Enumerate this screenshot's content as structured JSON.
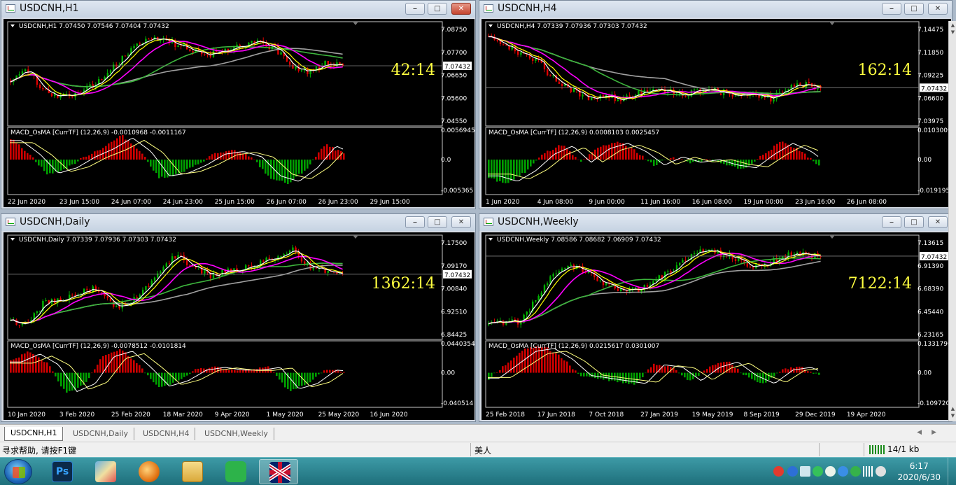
{
  "windows": [
    {
      "id": "h1",
      "title": "USDCNH,H1",
      "header": "USDCNH,H1  7.07450 7.07546 7.07404 7.07432",
      "countdown": "42:14",
      "price_labels": [
        "7.08750",
        "7.07700",
        "7.06650",
        "7.05600",
        "7.04550"
      ],
      "current_price": "7.07432",
      "macd_label": "MACD_OsMA [CurrTF] (12,26,9) -0.0010968 -0.0011167",
      "macd_scale": [
        "0.0056945",
        "0.0",
        "-0.005365"
      ],
      "time_labels": [
        "22 Jun 2020",
        "23 Jun 15:00",
        "24 Jun 07:00",
        "24 Jun 23:00",
        "25 Jun 15:00",
        "26 Jun 07:00",
        "26 Jun 23:00",
        "29 Jun 15:00"
      ],
      "close_active": true
    },
    {
      "id": "h4",
      "title": "USDCNH,H4",
      "header": "USDCNH,H4  7.07339 7.07936 7.07303 7.07432",
      "countdown": "162:14",
      "price_labels": [
        "7.14475",
        "7.11850",
        "7.09225",
        "7.06600",
        "7.03975"
      ],
      "current_price": "7.07432",
      "macd_label": "MACD_OsMA [CurrTF] (12,26,9) 0.0008103 0.0025457",
      "macd_scale": [
        "0.0103009",
        "0.00",
        "-0.019195"
      ],
      "time_labels": [
        "1 Jun 2020",
        "4 Jun 08:00",
        "9 Jun 00:00",
        "11 Jun 16:00",
        "16 Jun 08:00",
        "19 Jun 00:00",
        "23 Jun 16:00",
        "26 Jun 08:00"
      ],
      "close_active": false
    },
    {
      "id": "daily",
      "title": "USDCNH,Daily",
      "header": "USDCNH,Daily  7.07339 7.07936 7.07303 7.07432",
      "countdown": "1362:14",
      "price_labels": [
        "7.17500",
        "7.09170",
        "7.00840",
        "6.92510",
        "6.84425"
      ],
      "current_price": "7.07432",
      "macd_label": "MACD_OsMA [CurrTF] (12,26,9) -0.0078512 -0.0101814",
      "macd_scale": [
        "0.0440354",
        "0.00",
        "-0.040514"
      ],
      "time_labels": [
        "10 Jan 2020",
        "3 Feb 2020",
        "25 Feb 2020",
        "18 Mar 2020",
        "9 Apr 2020",
        "1 May 2020",
        "25 May 2020",
        "16 Jun 2020"
      ],
      "close_active": false
    },
    {
      "id": "weekly",
      "title": "USDCNH,Weekly",
      "header": "USDCNH,Weekly  7.08586 7.08682 7.06909 7.07432",
      "countdown": "7122:14",
      "price_labels": [
        "7.13615",
        "6.91390",
        "6.68390",
        "6.45440",
        "6.23165"
      ],
      "current_price": "7.07432",
      "macd_label": "MACD_OsMA [CurrTF] (12,26,9) 0.0215617 0.0301007",
      "macd_scale": [
        "0.1331796",
        "0.00",
        "-0.109720"
      ],
      "time_labels": [
        "25 Feb 2018",
        "17 Jun 2018",
        "7 Oct 2018",
        "27 Jan 2019",
        "19 May 2019",
        "8 Sep 2019",
        "29 Dec 2019",
        "19 Apr 2020"
      ],
      "close_active": false
    }
  ],
  "tabs": [
    "USDCNH,H1",
    "USDCNH,Daily",
    "USDCNH,H4",
    "USDCNH,Weekly"
  ],
  "active_tab": "USDCNH,H1",
  "status": {
    "help": "寻求帮助, 请按F1键",
    "profile": "美人",
    "traffic": "14/1 kb"
  },
  "clock": {
    "time": "6:17",
    "date": "2020/6/30"
  },
  "colors": {
    "bull": "#00b400",
    "bear": "#e00000",
    "ma_fast": "#ffffff",
    "ma_yellow": "#ffff00",
    "ma_magenta": "#ff00ff",
    "ma_green": "#3cb43c",
    "ma_grey": "#a0a0a0",
    "countdown": "#ffff40"
  }
}
